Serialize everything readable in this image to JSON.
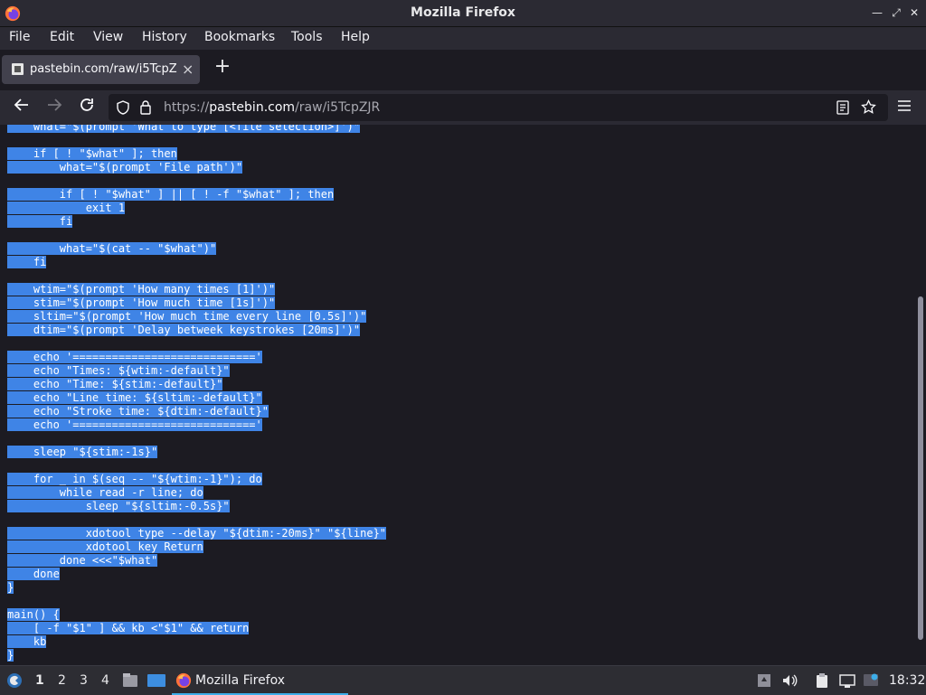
{
  "window": {
    "title": "Mozilla Firefox"
  },
  "menu": [
    "File",
    "Edit",
    "View",
    "History",
    "Bookmarks",
    "Tools",
    "Help"
  ],
  "tab": {
    "title": "pastebin.com/raw/i5TcpZ",
    "close": "×"
  },
  "newtab": "+",
  "url": {
    "prefix": "https://",
    "host": "pastebin.com",
    "path": "/raw/i5TcpZJR"
  },
  "code_lines": [
    {
      "text": "    what=\"$(prompt 'What to type [<file selection>]')\"",
      "hl": true
    },
    {
      "text": "",
      "hl": false
    },
    {
      "text": "    if [ ! \"$what\" ]; then",
      "hl": true
    },
    {
      "text": "        what=\"$(prompt 'File path')\"",
      "hl": true
    },
    {
      "text": "",
      "hl": false
    },
    {
      "text": "        if [ ! \"$what\" ] || [ ! -f \"$what\" ]; then",
      "hl": true
    },
    {
      "text": "            exit 1",
      "hl": true
    },
    {
      "text": "        fi",
      "hl": true
    },
    {
      "text": "",
      "hl": false
    },
    {
      "text": "        what=\"$(cat -- \"$what\")\"",
      "hl": true
    },
    {
      "text": "    fi",
      "hl": true
    },
    {
      "text": "",
      "hl": false
    },
    {
      "text": "    wtim=\"$(prompt 'How many times [1]')\"",
      "hl": true
    },
    {
      "text": "    stim=\"$(prompt 'How much time [1s]')\"",
      "hl": true
    },
    {
      "text": "    sltim=\"$(prompt 'How much time every line [0.5s]')\"",
      "hl": true
    },
    {
      "text": "    dtim=\"$(prompt 'Delay betweek keystrokes [20ms]')\"",
      "hl": true
    },
    {
      "text": "",
      "hl": false
    },
    {
      "text": "    echo '============================'",
      "hl": true
    },
    {
      "text": "    echo \"Times: ${wtim:-default}\"",
      "hl": true
    },
    {
      "text": "    echo \"Time: ${stim:-default}\"",
      "hl": true
    },
    {
      "text": "    echo \"Line time: ${sltim:-default}\"",
      "hl": true
    },
    {
      "text": "    echo \"Stroke time: ${dtim:-default}\"",
      "hl": true
    },
    {
      "text": "    echo '============================'",
      "hl": true
    },
    {
      "text": "",
      "hl": false
    },
    {
      "text": "    sleep \"${stim:-1s}\"",
      "hl": true
    },
    {
      "text": "",
      "hl": false
    },
    {
      "text": "    for _ in $(seq -- \"${wtim:-1}\"); do",
      "hl": true
    },
    {
      "text": "        while read -r line; do",
      "hl": true
    },
    {
      "text": "            sleep \"${sltim:-0.5s}\"",
      "hl": true
    },
    {
      "text": "",
      "hl": false
    },
    {
      "text": "            xdotool type --delay \"${dtim:-20ms}\" \"${line}\"",
      "hl": true
    },
    {
      "text": "            xdotool key Return",
      "hl": true
    },
    {
      "text": "        done <<<\"$what\"",
      "hl": true
    },
    {
      "text": "    done",
      "hl": true
    },
    {
      "text": "}",
      "hl": true
    },
    {
      "text": "",
      "hl": false
    },
    {
      "text": "main() {",
      "hl": true
    },
    {
      "text": "    [ -f \"$1\" ] && kb <\"$1\" && return",
      "hl": true
    },
    {
      "text": "    kb",
      "hl": true
    },
    {
      "text": "}",
      "hl": true
    }
  ],
  "taskbar": {
    "workspaces": [
      "1",
      "2",
      "3",
      "4"
    ],
    "task_label": "Mozilla Firefox",
    "clock": "18:32"
  },
  "colors": {
    "selection": "#3f84e6",
    "accent": "#3daee9"
  }
}
